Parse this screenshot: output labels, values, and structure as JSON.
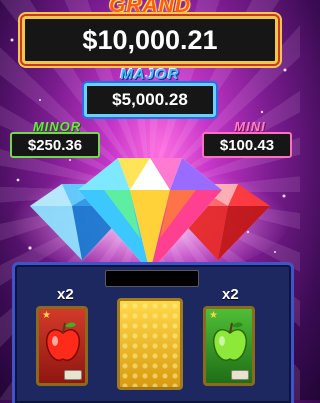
{
  "jackpots": {
    "grand": {
      "label": "GRAND",
      "value": "$10,000.21"
    },
    "major": {
      "label": "MAJOR",
      "value": "$5,000.28"
    },
    "minor": {
      "label": "MINOR",
      "value": "$250.36"
    },
    "mini": {
      "label": "MINI",
      "value": "$100.43"
    }
  },
  "center_icon": "diamond-gem-icon",
  "cards": {
    "left": {
      "multiplier": "x2",
      "fruit": "red-apple-icon"
    },
    "middle": {
      "state": "face-down",
      "icon": "gold-card-back"
    },
    "right": {
      "multiplier": "x2",
      "fruit": "green-apple-icon"
    }
  },
  "colors": {
    "grand_text": "#ff5a1a",
    "major_text": "#4fb4ff",
    "minor_text": "#6fe24a",
    "mini_text": "#ff7fc8",
    "panel": "#1d2760",
    "background": "#7a1c8f"
  }
}
